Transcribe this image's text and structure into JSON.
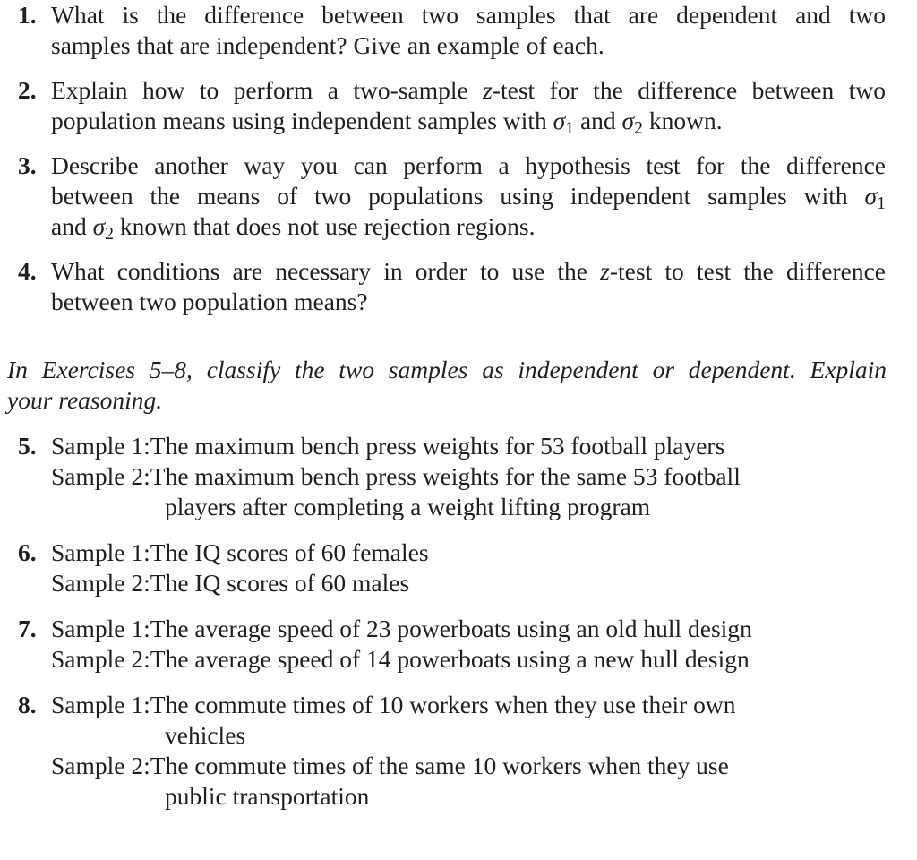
{
  "questions": [
    {
      "number": "1.",
      "lines": [
        "What is the difference between two samples that are dependent and two",
        "samples that are independent? Give an example of each."
      ]
    },
    {
      "number": "2.",
      "line1_a": "Explain how to perform a two-sample ",
      "line1_z": "z",
      "line1_b": "-test for the difference between two",
      "line2_a": "population means using independent samples with ",
      "sigma": "σ",
      "sub1": "1",
      "and": " and ",
      "sub2": "2",
      "line2_b": " known."
    },
    {
      "number": "3.",
      "line1": "Describe another way you can perform a hypothesis test for the difference",
      "line2_a": "between the means of two populations using independent samples with ",
      "sigma": "σ",
      "sub1": "1",
      "line3_a": "and ",
      "sub2": "2",
      "line3_b": " known that does not use rejection regions."
    },
    {
      "number": "4.",
      "line1_a": "What conditions are necessary in order to use the ",
      "line1_z": "z",
      "line1_b": "-test to test the difference",
      "line2": "between two population means?"
    }
  ],
  "instructions": {
    "line1": "In Exercises 5–8, classify the two samples as independent or dependent. Explain",
    "line2": "your reasoning."
  },
  "exercises": [
    {
      "number": "5.",
      "samples": [
        {
          "label": "Sample 1: ",
          "lines": [
            "The maximum bench press weights for 53 football players"
          ]
        },
        {
          "label": "Sample 2: ",
          "lines": [
            "The maximum bench press weights for the same 53 football",
            "players after completing a weight lifting program"
          ]
        }
      ]
    },
    {
      "number": "6.",
      "samples": [
        {
          "label": "Sample 1: ",
          "lines": [
            "The IQ scores of 60 females"
          ]
        },
        {
          "label": "Sample 2: ",
          "lines": [
            "The IQ scores of 60 males"
          ]
        }
      ]
    },
    {
      "number": "7.",
      "samples": [
        {
          "label": "Sample 1: ",
          "lines": [
            "The average speed of 23 powerboats using an old hull design"
          ]
        },
        {
          "label": "Sample 2: ",
          "lines": [
            "The average speed of 14 powerboats using a new hull design"
          ]
        }
      ]
    },
    {
      "number": "8.",
      "samples": [
        {
          "label": "Sample 1: ",
          "lines": [
            "The commute times of 10 workers when they use their own",
            "vehicles"
          ]
        },
        {
          "label": "Sample 2: ",
          "lines": [
            "The commute times of the same 10 workers when they use",
            "public transportation"
          ]
        }
      ]
    }
  ]
}
